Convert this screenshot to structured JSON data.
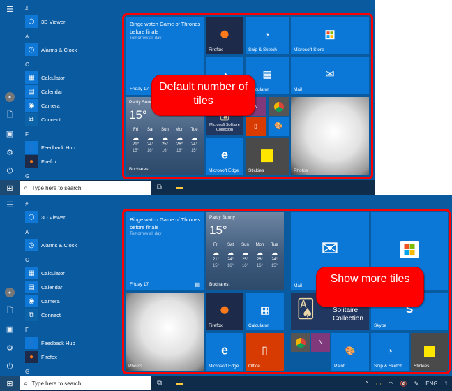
{
  "rail": {
    "icons": [
      "hamburger-menu-icon",
      "user-avatar-icon",
      "documents-icon",
      "pictures-icon",
      "settings-icon",
      "power-icon"
    ]
  },
  "app_list": {
    "groups": [
      {
        "header": "#",
        "apps": [
          {
            "label": "3D Viewer",
            "icon": "cube-icon"
          }
        ]
      },
      {
        "header": "A",
        "apps": [
          {
            "label": "Alarms & Clock",
            "icon": "alarm-clock-icon"
          }
        ]
      },
      {
        "header": "C",
        "apps": [
          {
            "label": "Calculator",
            "icon": "calculator-icon"
          },
          {
            "label": "Calendar",
            "icon": "calendar-icon"
          },
          {
            "label": "Camera",
            "icon": "camera-icon"
          },
          {
            "label": "Connect",
            "icon": "connect-icon"
          }
        ]
      },
      {
        "header": "F",
        "apps": [
          {
            "label": "Feedback Hub",
            "icon": "feedback-hub-icon"
          },
          {
            "label": "Firefox",
            "icon": "firefox-icon"
          }
        ]
      },
      {
        "header": "G",
        "apps": []
      }
    ]
  },
  "calendar_tile": {
    "title": "Binge watch Game of Thrones before finale",
    "subtitle": "Tomorrow all day",
    "date": "Friday 17"
  },
  "weather_tile": {
    "condition": "Partly Sunny",
    "temp": "15°",
    "city": "Bucharest",
    "days": [
      {
        "day": "Fri",
        "hi": "21°",
        "lo": "15°"
      },
      {
        "day": "Sat",
        "hi": "24°",
        "lo": "16°"
      },
      {
        "day": "Sun",
        "hi": "25°",
        "lo": "16°"
      },
      {
        "day": "Mon",
        "hi": "26°",
        "lo": "16°"
      },
      {
        "day": "Tue",
        "hi": "24°",
        "lo": "15°"
      }
    ]
  },
  "tiles": {
    "firefox": "Firefox",
    "snip": "Snip & Sketch",
    "store": "Microsoft Store",
    "calculator": "Calculator",
    "mail": "Mail",
    "solitaire_small": "Microsoft Solitaire Collection",
    "solitaire_large": "Solitaire Collection",
    "edge": "Microsoft Edge",
    "stickies": "Stickies",
    "photos": "Photos",
    "office": "Office",
    "skype": "Skype",
    "paint": "Paint"
  },
  "callouts": {
    "top": "Default number of tiles",
    "bottom": "Show more tiles"
  },
  "taskbar": {
    "search_placeholder": "Type here to search",
    "language": "ENG",
    "clock_partial": "1"
  },
  "colors": {
    "tile_blue": "#0b78d7",
    "start_bg": "#0a5aa0",
    "highlight_red": "#ff0000",
    "taskbar": "#0f2c4a"
  }
}
